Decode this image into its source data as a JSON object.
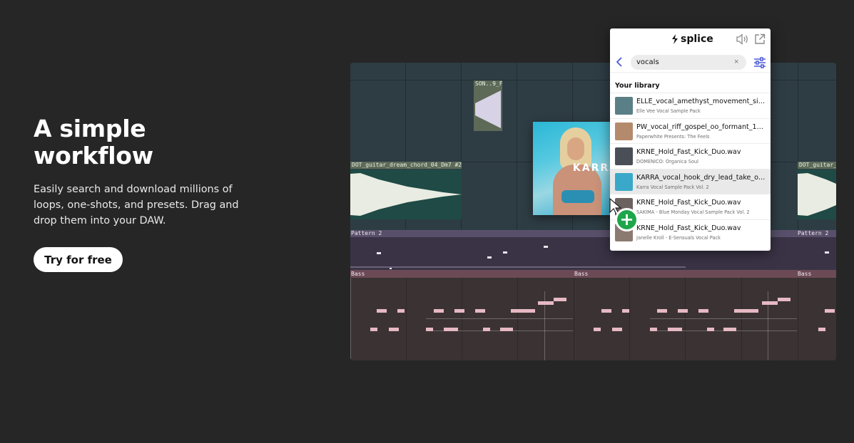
{
  "hero": {
    "title_line1": "A simple",
    "title_line2": "workflow",
    "description_line1": "Easily search and download millions of",
    "description_line2": "loops, one-shots, and presets. Drag and",
    "description_line3": "drop them into your DAW.",
    "cta_label": "Try for free"
  },
  "daw": {
    "clip_small": "SON..9_F",
    "clip_guitar": "DOT_guitar_dream_chord_04_Dm7 #2",
    "clip_guitar_right": "DOT_guitar_",
    "pattern_label": "Pattern 2",
    "pattern_label_right": "Pattern 2",
    "bass_label": "Bass",
    "bass_label_mid": "Bass",
    "bass_label_right": "Bass"
  },
  "cover": {
    "title": "KARRA"
  },
  "splice": {
    "logo_text": "splice",
    "search_value": "vocals",
    "clear_icon": "×",
    "section_title": "Your library",
    "items": [
      {
        "name": "ELLE_vocal_amethyst_movement_sing...",
        "pack": "Elle Vee Vocal Sample Pack",
        "thumb": "#5b7f86"
      },
      {
        "name": "PW_vocal_riff_gospel_oo_formant_110...",
        "pack": "Paperwhite Presents: The Feels",
        "thumb": "#b48a6d"
      },
      {
        "name": "KRNE_Hold_Fast_Kick_Duo.wav",
        "pack": "DOMENICO: Organica Soul",
        "thumb": "#4a4f57"
      },
      {
        "name": "KARRA_vocal_hook_dry_lead_take_on...",
        "pack": "Karra Vocal Sample Pack Vol. 2",
        "thumb": "#3aa8c8"
      },
      {
        "name": "KRNE_Hold_Fast_Kick_Duo.wav",
        "pack": "SAKIMA - Blue Monday Vocal Sample Pack Vol. 2",
        "thumb": "#6c6260"
      },
      {
        "name": "KRNE_Hold_Fast_Kick_Duo.wav",
        "pack": "Janelle Kroll - E-Sensuals Vocal Pack",
        "thumb": "#8b7a70"
      }
    ]
  },
  "drag": {
    "plus_symbol": "+"
  }
}
